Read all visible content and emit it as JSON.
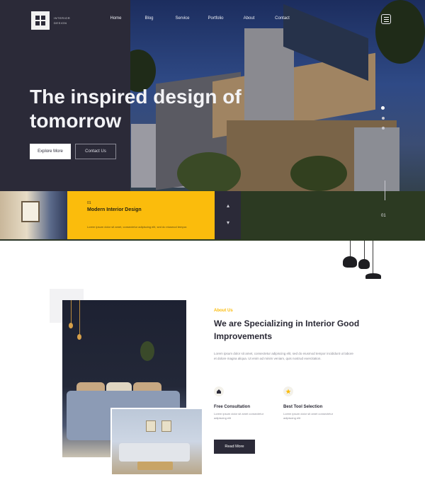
{
  "brand": {
    "line1": "INTERIOR",
    "line2": "DESIGN"
  },
  "nav": {
    "items": [
      {
        "label": "Home"
      },
      {
        "label": "Blog"
      },
      {
        "label": "Service"
      },
      {
        "label": "Portfolio"
      },
      {
        "label": "About"
      },
      {
        "label": "Contact"
      }
    ]
  },
  "hero": {
    "title": "The inspired design of tomorrow",
    "primary_button": "Explore More",
    "secondary_button": "Contact Us",
    "slide_number": "01"
  },
  "feature_strip": {
    "label": "01",
    "title": "Modern Interior Design",
    "text": "Lorem ipsum dolor sit amet, consectetur adipiscing elit, sed do eiusmod tempor."
  },
  "about": {
    "label": "About Us",
    "title": "We are Specializing in Interior Good Improvements",
    "text": "Lorem ipsum dolor sit amet, consectetur adipiscing elit, sed do eiusmod tempor incididunt ut labore et dolore magna aliqua. Ut enim ad minim veniam, quis nostrud exercitation.",
    "features": [
      {
        "icon": "home-icon",
        "title": "Free Consultation",
        "text": "Lorem ipsum dolor sit amet consectetur adipiscing elit"
      },
      {
        "icon": "star-icon",
        "title": "Best Tool Selection",
        "text": "Lorem ipsum dolor sit amet consectetur adipiscing elit"
      }
    ],
    "button": "Read More"
  },
  "colors": {
    "dark": "#2b2a38",
    "accent": "#fbbc0c",
    "white": "#ffffff"
  }
}
